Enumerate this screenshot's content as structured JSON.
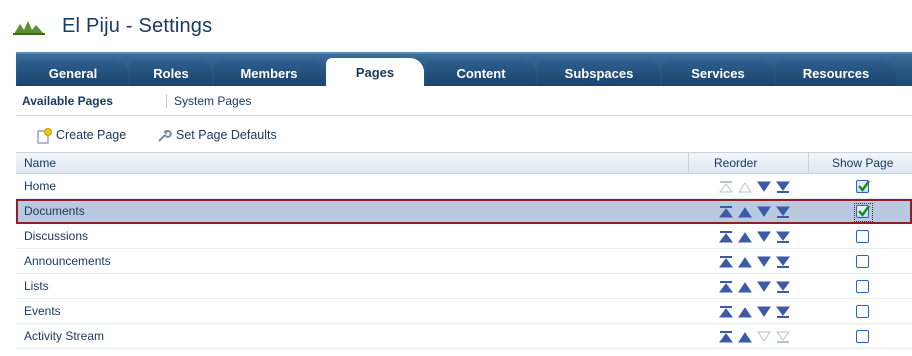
{
  "window": {
    "title": "El Piju - Settings"
  },
  "tabs": [
    {
      "label": "General",
      "active": false
    },
    {
      "label": "Roles",
      "active": false
    },
    {
      "label": "Members",
      "active": false
    },
    {
      "label": "Pages",
      "active": true
    },
    {
      "label": "Content",
      "active": false
    },
    {
      "label": "Subspaces",
      "active": false
    },
    {
      "label": "Services",
      "active": false
    },
    {
      "label": "Resources",
      "active": false
    }
  ],
  "subnav": [
    {
      "label": "Available Pages",
      "active": true
    },
    {
      "label": "System Pages",
      "active": false
    }
  ],
  "toolbar": {
    "create_label": "Create Page",
    "defaults_label": "Set Page Defaults"
  },
  "table": {
    "headers": {
      "name": "Name",
      "reorder": "Reorder",
      "show": "Show Page"
    },
    "rows": [
      {
        "name": "Home",
        "show": true,
        "selected": false
      },
      {
        "name": "Documents",
        "show": true,
        "selected": true
      },
      {
        "name": "Discussions",
        "show": false,
        "selected": false
      },
      {
        "name": "Announcements",
        "show": false,
        "selected": false
      },
      {
        "name": "Lists",
        "show": false,
        "selected": false
      },
      {
        "name": "Events",
        "show": false,
        "selected": false
      },
      {
        "name": "Activity Stream",
        "show": false,
        "selected": false
      }
    ]
  },
  "colors": {
    "tab_bar": "#2a557f",
    "selected_row": "#b9c9e0",
    "selected_outline": "#8c1f2c",
    "text": "#1c3a63"
  }
}
